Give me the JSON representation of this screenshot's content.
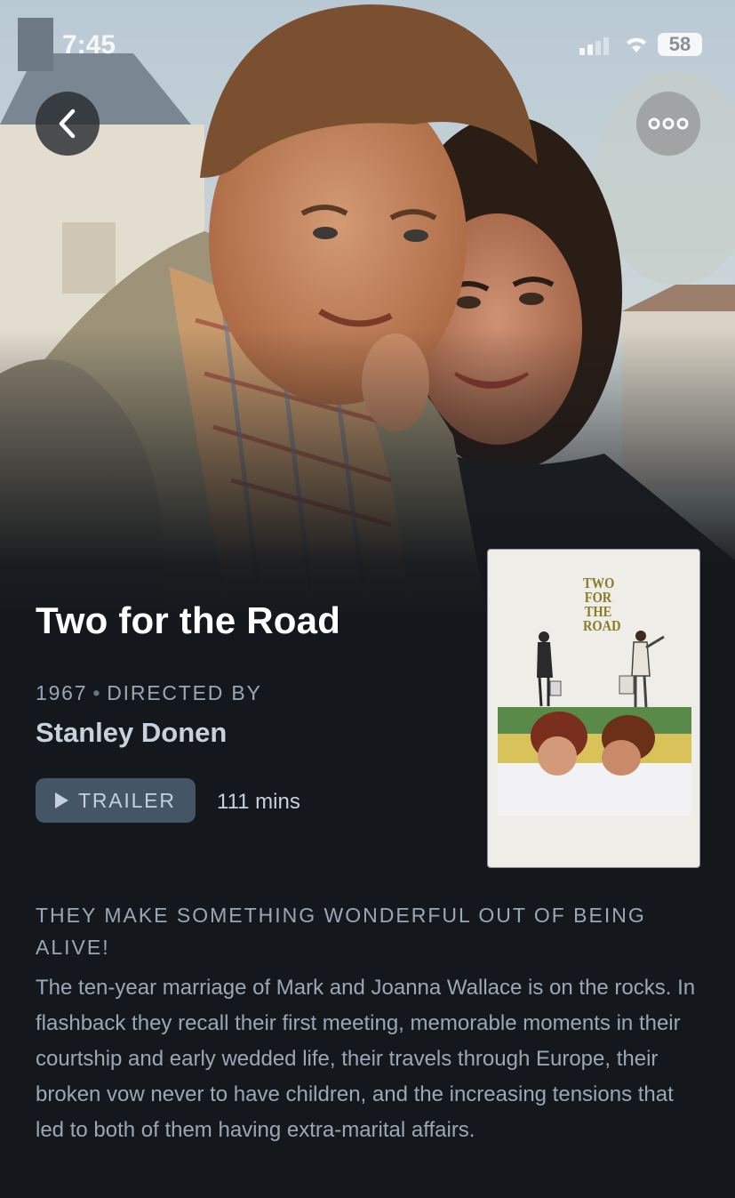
{
  "status_bar": {
    "time": "7:45",
    "battery": "58"
  },
  "film": {
    "title": "Two for the Road",
    "year": "1967",
    "directed_by_label": "DIRECTED BY",
    "director": "Stanley Donen",
    "trailer_label": "TRAILER",
    "runtime": "111 mins",
    "tagline": "THEY MAKE SOMETHING WONDERFUL OUT OF BEING ALIVE!",
    "synopsis": "The ten-year marriage of Mark and Joanna Wallace is on the rocks. In flashback they recall their first meeting, memorable moments in their courtship and early wedded life, their travels through Europe, their broken vow never to have children, and the increasing tensions that led to both of them having extra-marital affairs.",
    "poster_title": "TWO FOR THE ROAD"
  },
  "icons": {
    "back": "chevron-left-icon",
    "more": "ellipsis-icon",
    "play": "play-icon"
  },
  "colors": {
    "background": "#14181c",
    "accent_button": "#445566",
    "muted_text": "#9ba7b4"
  }
}
